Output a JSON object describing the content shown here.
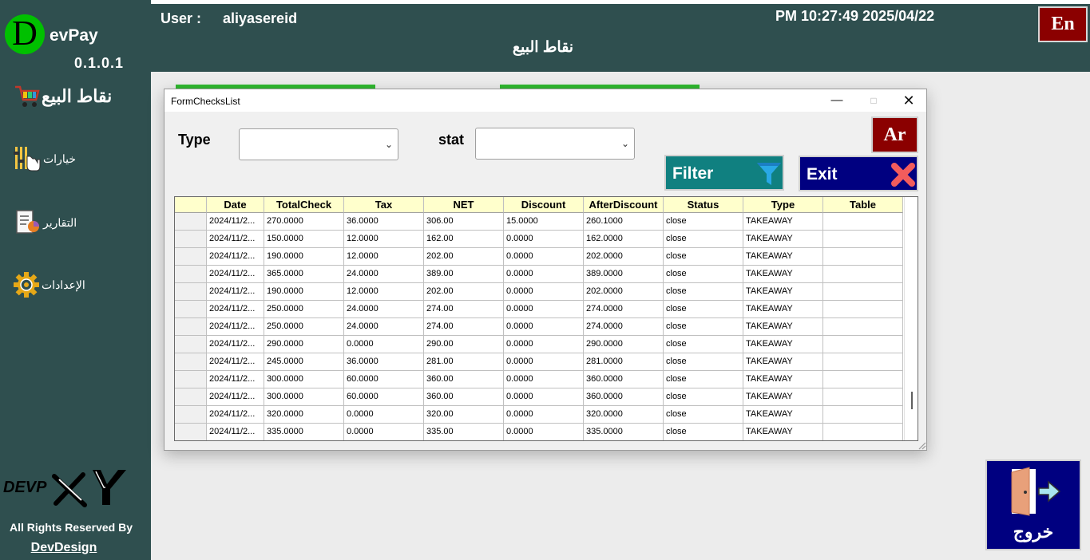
{
  "header": {
    "user_label": "User :",
    "user_name": "aliyasereid",
    "datetime": "PM 10:27:49 2025/04/22",
    "title": "نقاط البيع",
    "lang_button": "En"
  },
  "sidebar": {
    "logo_letter": "D",
    "logo_text": "evPay",
    "version": "0.1.0.1",
    "section_title": "نقاط البيع",
    "items": [
      {
        "label": "خيارات",
        "icon": "options-hand-icon"
      },
      {
        "label": "التقارير",
        "icon": "reports-icon"
      },
      {
        "label": "الإعدادات",
        "icon": "gear-icon"
      }
    ],
    "rights_text": "All Rights Reserved By",
    "rights_link": "DevDesign"
  },
  "exit_main": {
    "label": "خروج"
  },
  "window": {
    "title": "FormChecksList",
    "type_label": "Type",
    "type_value": "",
    "stat_label": "stat",
    "stat_value": "",
    "ar_button": "Ar",
    "filter_button": "Filter",
    "exit_button": "Exit",
    "columns": [
      "Date",
      "TotalCheck",
      "Tax",
      "NET",
      "Discount",
      "AfterDiscount",
      "Status",
      "Type",
      "Table"
    ],
    "rows": [
      [
        "2024/11/2...",
        "270.0000",
        "36.0000",
        "306.00",
        "15.0000",
        "260.1000",
        "close",
        "TAKEAWAY",
        ""
      ],
      [
        "2024/11/2...",
        "150.0000",
        "12.0000",
        "162.00",
        "0.0000",
        "162.0000",
        "close",
        "TAKEAWAY",
        ""
      ],
      [
        "2024/11/2...",
        "190.0000",
        "12.0000",
        "202.00",
        "0.0000",
        "202.0000",
        "close",
        "TAKEAWAY",
        ""
      ],
      [
        "2024/11/2...",
        "365.0000",
        "24.0000",
        "389.00",
        "0.0000",
        "389.0000",
        "close",
        "TAKEAWAY",
        ""
      ],
      [
        "2024/11/2...",
        "190.0000",
        "12.0000",
        "202.00",
        "0.0000",
        "202.0000",
        "close",
        "TAKEAWAY",
        ""
      ],
      [
        "2024/11/2...",
        "250.0000",
        "24.0000",
        "274.00",
        "0.0000",
        "274.0000",
        "close",
        "TAKEAWAY",
        ""
      ],
      [
        "2024/11/2...",
        "250.0000",
        "24.0000",
        "274.00",
        "0.0000",
        "274.0000",
        "close",
        "TAKEAWAY",
        ""
      ],
      [
        "2024/11/2...",
        "290.0000",
        "0.0000",
        "290.00",
        "0.0000",
        "290.0000",
        "close",
        "TAKEAWAY",
        ""
      ],
      [
        "2024/11/2...",
        "245.0000",
        "36.0000",
        "281.00",
        "0.0000",
        "281.0000",
        "close",
        "TAKEAWAY",
        ""
      ],
      [
        "2024/11/2...",
        "300.0000",
        "60.0000",
        "360.00",
        "0.0000",
        "360.0000",
        "close",
        "TAKEAWAY",
        ""
      ],
      [
        "2024/11/2...",
        "300.0000",
        "60.0000",
        "360.00",
        "0.0000",
        "360.0000",
        "close",
        "TAKEAWAY",
        ""
      ],
      [
        "2024/11/2...",
        "320.0000",
        "0.0000",
        "320.00",
        "0.0000",
        "320.0000",
        "close",
        "TAKEAWAY",
        ""
      ],
      [
        "2024/11/2...",
        "335.0000",
        "0.0000",
        "335.00",
        "0.0000",
        "335.0000",
        "close",
        "TAKEAWAY",
        ""
      ]
    ]
  },
  "colors": {
    "sidebar_bg": "#2f4f4f",
    "lang_button_bg": "#8b0000",
    "filter_bg": "#108080",
    "exit_bg": "#000080",
    "grid_header_bg": "#ffffcc"
  }
}
